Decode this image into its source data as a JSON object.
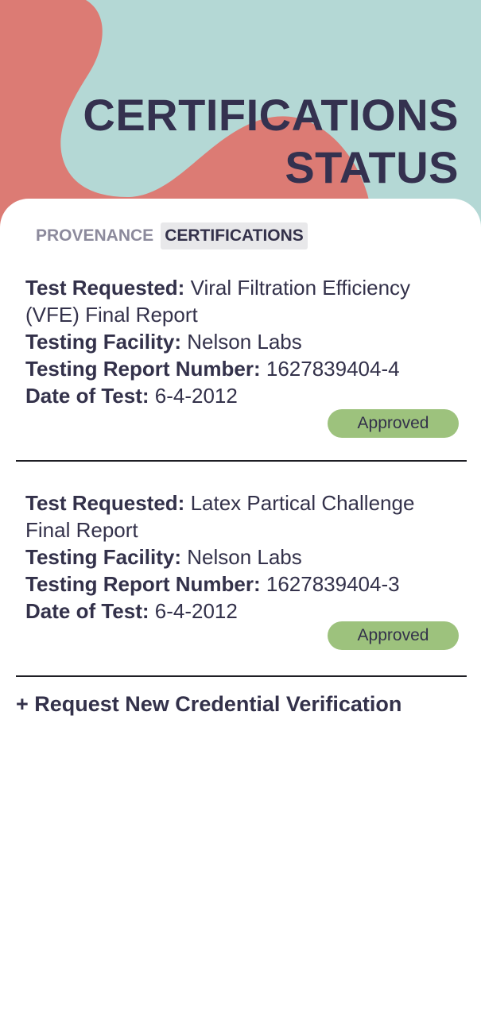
{
  "header": {
    "title_line1": "CERTIFICATIONS",
    "title_line2": "STATUS"
  },
  "tabs": [
    {
      "label": "PROVENANCE",
      "active": false
    },
    {
      "label": "CERTIFICATIONS",
      "active": true
    }
  ],
  "certifications": [
    {
      "test_requested_label": "Test Requested:",
      "test_requested_value": "Viral Filtration Efficiency (VFE) Final Report",
      "facility_label": "Testing Facility:",
      "facility_value": "Nelson Labs",
      "report_number_label": "Testing Report Number:",
      "report_number_value": "1627839404-4",
      "date_label": "Date of Test:",
      "date_value": "6-4-2012",
      "status": "Approved"
    },
    {
      "test_requested_label": "Test Requested:",
      "test_requested_value": "Latex Partical Challenge Final Report",
      "facility_label": "Testing Facility:",
      "facility_value": "Nelson Labs",
      "report_number_label": "Testing Report Number:",
      "report_number_value": "1627839404-3",
      "date_label": "Date of Test:",
      "date_value": "6-4-2012",
      "status": "Approved"
    }
  ],
  "request_link": "+ Request New Credential Verification",
  "colors": {
    "background_teal": "#b4d8d5",
    "blob_coral": "#dc7b74",
    "title_text": "#34314f",
    "approved_green": "#9dc27d",
    "active_tab_bg": "#e8e8ea"
  }
}
